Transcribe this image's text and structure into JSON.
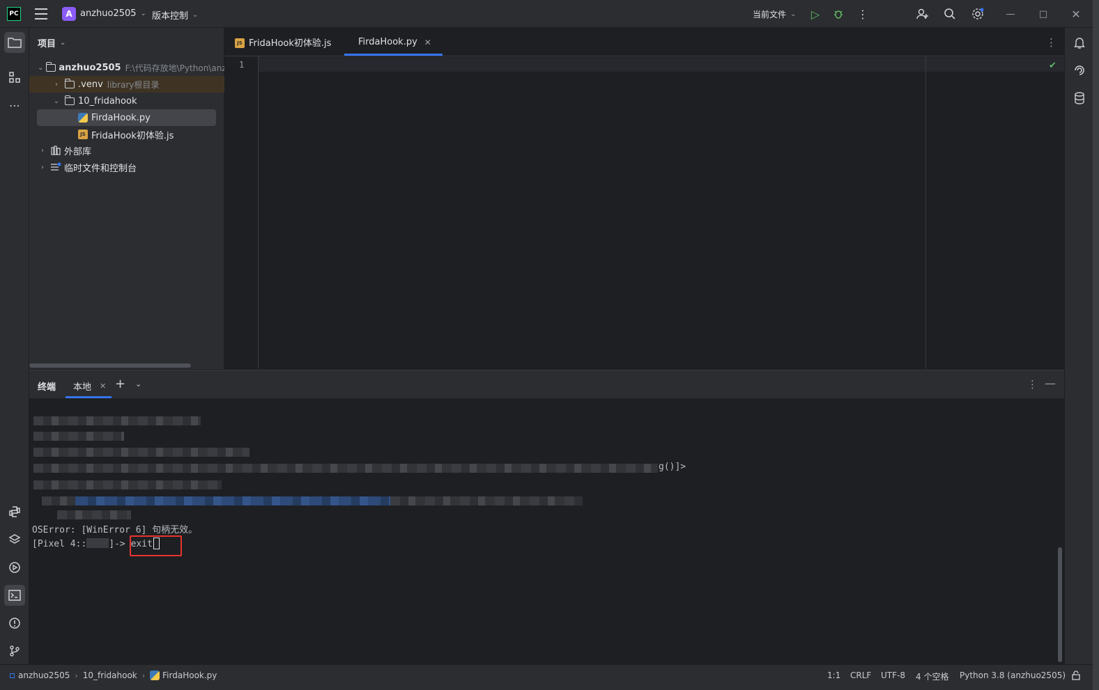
{
  "titlebar": {
    "logo_text": "PC",
    "project_badge": "A",
    "project_name": "anzhuo2505",
    "vcs_label": "版本控制",
    "run_config": "当前文件"
  },
  "project_panel": {
    "title": "项目",
    "tree": [
      {
        "label": "anzhuo2505",
        "extra": "F:\\代码存放地\\Python\\anzh"
      },
      {
        "label": ".venv",
        "extra": "library根目录"
      },
      {
        "label": "10_fridahook"
      },
      {
        "label": "FirdaHook.py"
      },
      {
        "label": "FridaHook初体验.js"
      },
      {
        "label": "外部库"
      },
      {
        "label": "临时文件和控制台"
      }
    ]
  },
  "editor": {
    "tabs": [
      {
        "label": "FridaHook初体验.js",
        "type": "js"
      },
      {
        "label": "FirdaHook.py",
        "type": "py",
        "active": true
      }
    ],
    "line_numbers": [
      "1"
    ]
  },
  "terminal": {
    "title": "终端",
    "tab_label": "本地",
    "visible_fragment": "g()]>",
    "error_line": "OSError: [WinError 6] 句柄无效。",
    "prompt_prefix": "[Pixel 4::",
    "prompt_mid": "]-> ",
    "command": "exit"
  },
  "statusbar": {
    "breadcrumb": [
      "anzhuo2505",
      "10_fridahook",
      "FirdaHook.py"
    ],
    "position": "1:1",
    "line_sep": "CRLF",
    "encoding": "UTF-8",
    "indent": "4 个空格",
    "interpreter": "Python 3.8 (anzhuo2505)"
  },
  "colors": {
    "accent": "#3574f0",
    "run_green": "#5fb865",
    "highlight_red": "#e8342e",
    "project_badge": "#8b5cf6"
  }
}
